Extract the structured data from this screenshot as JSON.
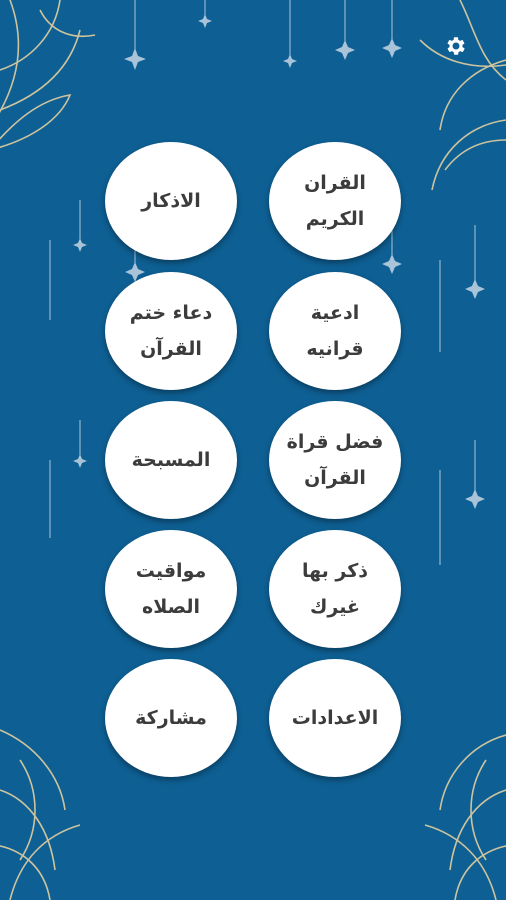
{
  "header": {
    "settings_icon": "gear-icon"
  },
  "colors": {
    "background": "#0e5f93",
    "button": "#ffffff",
    "text": "#3c3c3c",
    "ornament": "#e2cfa0"
  },
  "menu": {
    "items": [
      {
        "id": "quran",
        "label": "القران\nالكريم"
      },
      {
        "id": "azkar",
        "label": "الاذكار"
      },
      {
        "id": "quran-duas",
        "label": "ادعية\nقرانيه"
      },
      {
        "id": "khatm-dua",
        "label": "دعاء ختم\nالقرآن"
      },
      {
        "id": "reading-virtue",
        "label": "فضل قراة\nالقرآن"
      },
      {
        "id": "tasbih",
        "label": "المسبحة"
      },
      {
        "id": "share-dhikr",
        "label": "ذكر بها\nغيرك"
      },
      {
        "id": "prayer-times",
        "label": "مواقيت\nالصلاه"
      },
      {
        "id": "settings",
        "label": "الاعدادات"
      },
      {
        "id": "share",
        "label": "مشاركة"
      }
    ]
  }
}
